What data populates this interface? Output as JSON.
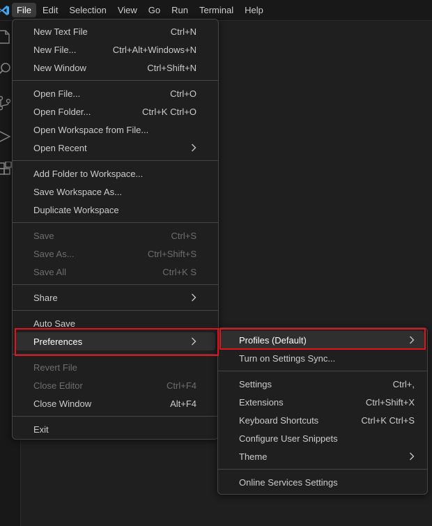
{
  "menubar": {
    "items": [
      "File",
      "Edit",
      "Selection",
      "View",
      "Go",
      "Run",
      "Terminal",
      "Help"
    ]
  },
  "activity_bar": {
    "icons": [
      "explorer-icon",
      "search-icon",
      "source-control-icon",
      "run-debug-icon",
      "extensions-icon"
    ]
  },
  "file_menu": {
    "groups": [
      [
        {
          "label": "New Text File",
          "key": "Ctrl+N"
        },
        {
          "label": "New File...",
          "key": "Ctrl+Alt+Windows+N"
        },
        {
          "label": "New Window",
          "key": "Ctrl+Shift+N"
        }
      ],
      [
        {
          "label": "Open File...",
          "key": "Ctrl+O"
        },
        {
          "label": "Open Folder...",
          "key": "Ctrl+K Ctrl+O"
        },
        {
          "label": "Open Workspace from File...",
          "key": ""
        },
        {
          "label": "Open Recent",
          "key": "",
          "submenu": true
        }
      ],
      [
        {
          "label": "Add Folder to Workspace...",
          "key": ""
        },
        {
          "label": "Save Workspace As...",
          "key": ""
        },
        {
          "label": "Duplicate Workspace",
          "key": ""
        }
      ],
      [
        {
          "label": "Save",
          "key": "Ctrl+S",
          "disabled": true
        },
        {
          "label": "Save As...",
          "key": "Ctrl+Shift+S",
          "disabled": true
        },
        {
          "label": "Save All",
          "key": "Ctrl+K S",
          "disabled": true
        }
      ],
      [
        {
          "label": "Share",
          "key": "",
          "submenu": true
        }
      ],
      [
        {
          "label": "Auto Save",
          "key": ""
        },
        {
          "label": "Preferences",
          "key": "",
          "submenu": true,
          "hover": true
        }
      ],
      [
        {
          "label": "Revert File",
          "key": "",
          "disabled": true
        },
        {
          "label": "Close Editor",
          "key": "Ctrl+F4",
          "disabled": true
        },
        {
          "label": "Close Window",
          "key": "Alt+F4"
        }
      ],
      [
        {
          "label": "Exit",
          "key": ""
        }
      ]
    ]
  },
  "preferences_menu": {
    "groups": [
      [
        {
          "label": "Profiles (Default)",
          "key": "",
          "submenu": true,
          "hover": true
        },
        {
          "label": "Turn on Settings Sync...",
          "key": ""
        }
      ],
      [
        {
          "label": "Settings",
          "key": "Ctrl+,"
        },
        {
          "label": "Extensions",
          "key": "Ctrl+Shift+X"
        },
        {
          "label": "Keyboard Shortcuts",
          "key": "Ctrl+K Ctrl+S"
        },
        {
          "label": "Configure User Snippets",
          "key": ""
        },
        {
          "label": "Theme",
          "key": "",
          "submenu": true
        }
      ],
      [
        {
          "label": "Online Services Settings",
          "key": ""
        }
      ]
    ]
  },
  "colors": {
    "accent": "#0078d4",
    "highlight_border": "#e0141e"
  }
}
